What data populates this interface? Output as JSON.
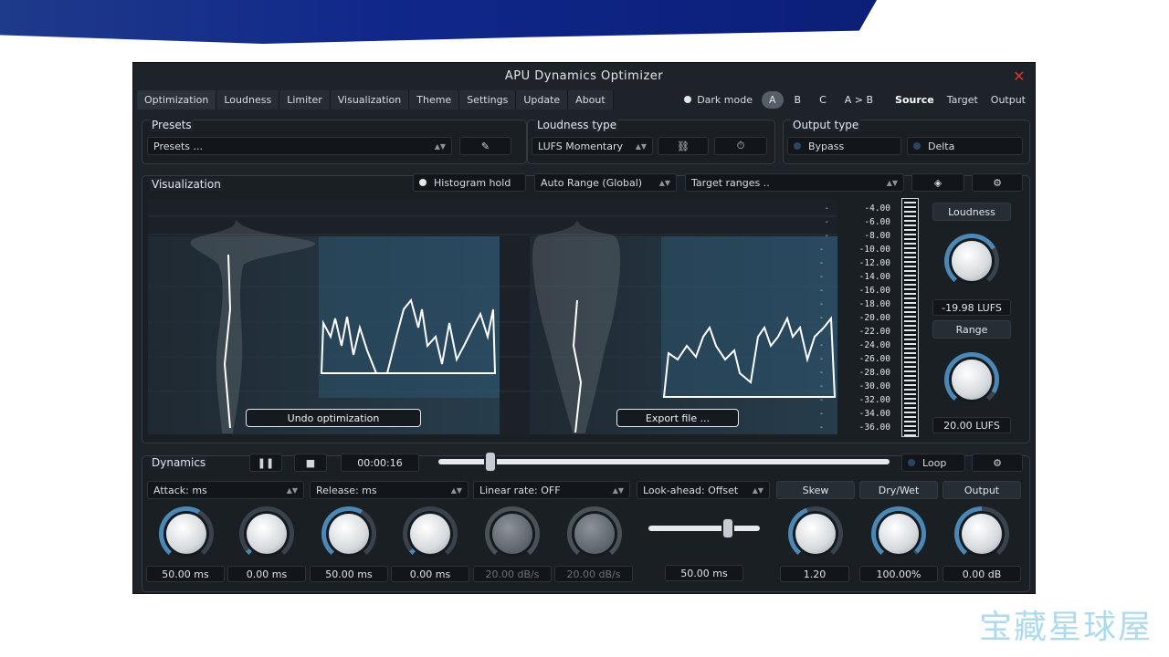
{
  "window": {
    "title": "APU Dynamics Optimizer"
  },
  "menu": [
    "Optimization",
    "Loudness",
    "Limiter",
    "Visualization",
    "Theme",
    "Settings",
    "Update",
    "About"
  ],
  "dark_mode_label": "Dark mode",
  "ab_slots": [
    "A",
    "B",
    "C",
    "A > B"
  ],
  "view_tabs": [
    "Source",
    "Target",
    "Output"
  ],
  "presets": {
    "title": "Presets",
    "value": "Presets ..."
  },
  "loudness_type": {
    "title": "Loudness type",
    "value": "LUFS Momentary"
  },
  "output_type": {
    "title": "Output type",
    "options": [
      "Bypass",
      "Delta"
    ]
  },
  "visualization": {
    "title": "Visualization",
    "histogram_hold": "Histogram hold",
    "range_mode": "Auto Range (Global)",
    "target_ranges": "Target ranges ..",
    "undo_button": "Undo optimization",
    "export_button": "Export file ...",
    "scale": [
      "-4.00",
      "-6.00",
      "-8.00",
      "-10.00",
      "-12.00",
      "-14.00",
      "-16.00",
      "-18.00",
      "-20.00",
      "-22.00",
      "-24.00",
      "-26.00",
      "-28.00",
      "-30.00",
      "-32.00",
      "-34.00",
      "-36.00"
    ]
  },
  "loudness_side": {
    "loudness_label": "Loudness",
    "loudness_value": "-19.98 LUFS",
    "range_label": "Range",
    "range_value": "20.00 LUFS"
  },
  "dynamics": {
    "title": "Dynamics",
    "time": "00:00:16",
    "loop_label": "Loop",
    "dropdowns": [
      "Attack: ms",
      "Release: ms",
      "Linear rate: OFF",
      "Look-ahead: Offset"
    ],
    "side_labels": [
      "Skew",
      "Dry/Wet",
      "Output"
    ],
    "values": [
      "50.00 ms",
      "0.00 ms",
      "50.00 ms",
      "0.00 ms",
      "20.00 dB/s",
      "20.00 dB/s",
      "50.00 ms",
      "1.20",
      "100.00%",
      "0.00 dB"
    ]
  },
  "watermark": "宝藏星球屋"
}
